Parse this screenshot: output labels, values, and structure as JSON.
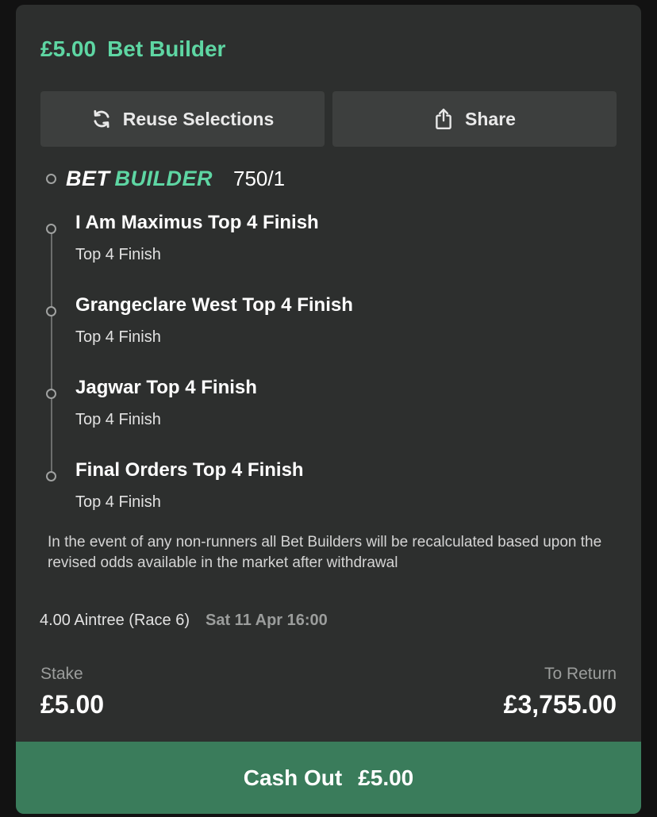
{
  "header": {
    "stake": "£5.00",
    "title": "Bet Builder"
  },
  "actions": {
    "reuse_label": "Reuse Selections",
    "share_label": "Share"
  },
  "bet_builder": {
    "label_part1": "BET",
    "label_part2": "BUILDER",
    "odds": "750/1"
  },
  "legs": [
    {
      "title": "I Am Maximus Top 4 Finish",
      "market": "Top 4 Finish"
    },
    {
      "title": "Grangeclare West Top 4 Finish",
      "market": "Top 4 Finish"
    },
    {
      "title": "Jagwar Top 4 Finish",
      "market": "Top 4 Finish"
    },
    {
      "title": "Final Orders Top 4 Finish",
      "market": "Top 4 Finish"
    }
  ],
  "notice": "In the event of any non-runners all Bet Builders will be recalculated based upon the revised odds available in the market after withdrawal",
  "event": {
    "name": "4.00 Aintree (Race 6)",
    "time": "Sat 11 Apr 16:00"
  },
  "summary": {
    "stake_label": "Stake",
    "stake_value": "£5.00",
    "return_label": "To Return",
    "return_value": "£3,755.00"
  },
  "cashout": {
    "label": "Cash Out",
    "amount": "£5.00"
  },
  "colors": {
    "accent": "#5ed6a3",
    "card": "#2d2f2e",
    "button": "#3d3f3e",
    "cashout": "#3a7c5b"
  },
  "icons": {
    "reuse": "refresh-icon",
    "share": "share-icon"
  }
}
